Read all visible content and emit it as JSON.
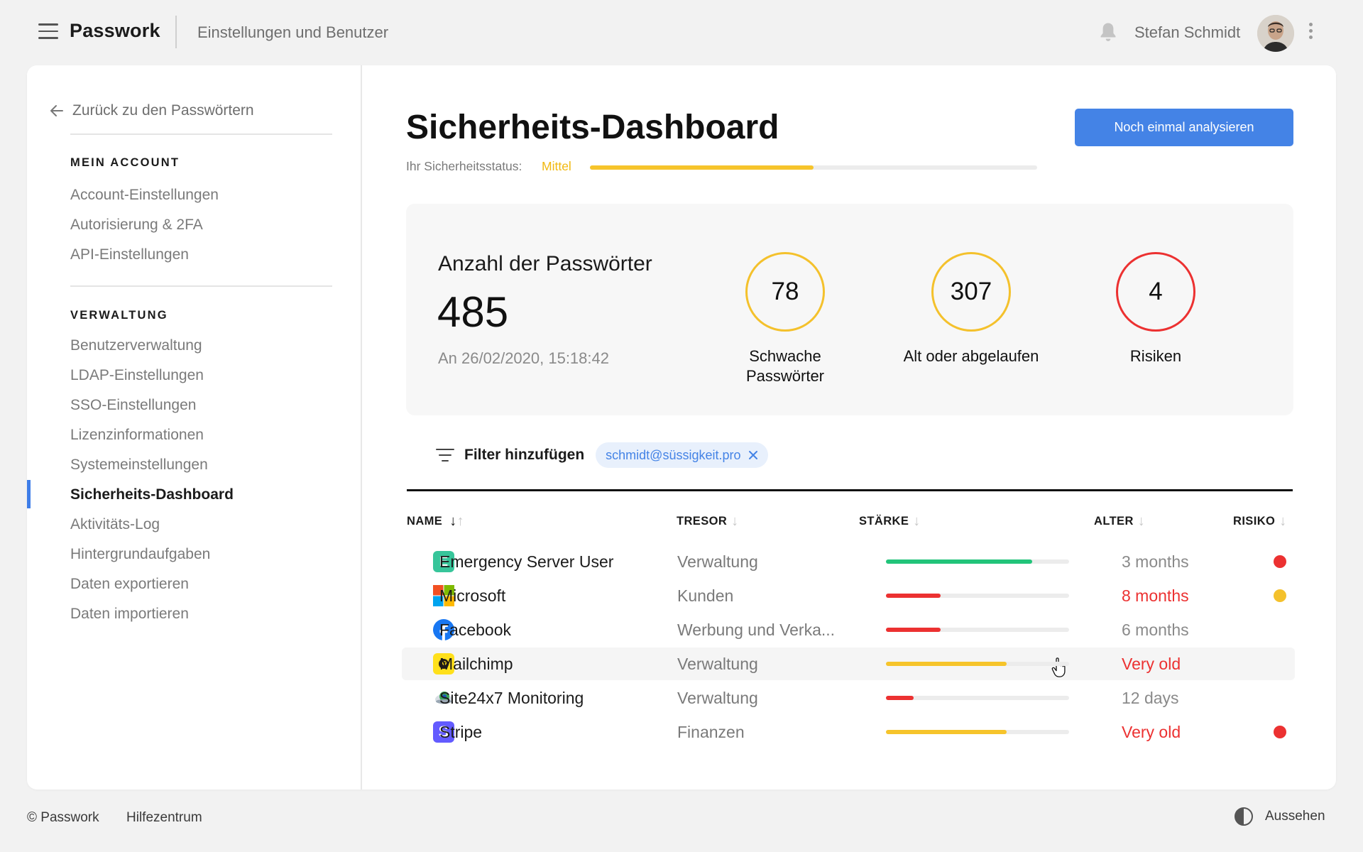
{
  "header": {
    "brand": "Passwork",
    "breadcrumb": "Einstellungen und Benutzer",
    "user_name": "Stefan Schmidt"
  },
  "sidebar": {
    "back_label": "Zurück zu den Passwörtern",
    "sections": [
      {
        "heading": "MEIN ACCOUNT",
        "items": [
          "Account-Einstellungen",
          "Autorisierung & 2FA",
          "API-Einstellungen"
        ]
      },
      {
        "heading": "VERWALTUNG",
        "items": [
          "Benutzerverwaltung",
          "LDAP-Einstellungen",
          "SSO-Einstellungen",
          "Lizenzinformationen",
          "Systemeinstellungen",
          "Sicherheits-Dashboard",
          "Aktivitäts-Log",
          "Hintergrundaufgaben",
          "Daten exportieren",
          "Daten importieren"
        ]
      }
    ],
    "active_item": "Sicherheits-Dashboard"
  },
  "main": {
    "title": "Sicherheits-Dashboard",
    "analyze_button": "Noch einmal analysieren",
    "status_label": "Ihr Sicherheitsstatus:",
    "status_value": "Mittel",
    "status_progress": 0.5,
    "summary": {
      "count_label": "Anzahl der Passwörter",
      "count": "485",
      "date": "An 26/02/2020, 15:18:42",
      "metrics": [
        {
          "value": "78",
          "label": "Schwache Passwörter",
          "color": "#f4c12c"
        },
        {
          "value": "307",
          "label": "Alt oder abgelaufen",
          "color": "#f4c12c"
        },
        {
          "value": "4",
          "label": "Risiken",
          "color": "#ec3131"
        }
      ]
    },
    "filter": {
      "label": "Filter hinzufügen",
      "chip": "schmidt@süssigkeit.pro"
    },
    "table": {
      "columns": [
        "NAME",
        "TRESOR",
        "STÄRKE",
        "ALTER",
        "RISIKO"
      ],
      "rows": [
        {
          "name": "Emergency Server User",
          "vault": "Verwaltung",
          "strength": 0.8,
          "strength_color": "#22c47a",
          "age": "3 months",
          "age_warn": false,
          "risk": "#ec3131",
          "icon": "letter-e-icon"
        },
        {
          "name": "Microsoft",
          "vault": "Kunden",
          "strength": 0.3,
          "strength_color": "#ec3131",
          "age": "8 months",
          "age_warn": true,
          "risk": "#f4c12c",
          "icon": "microsoft-icon"
        },
        {
          "name": "Facebook",
          "vault": "Werbung und Verka...",
          "strength": 0.3,
          "strength_color": "#ec3131",
          "age": "6 months",
          "age_warn": false,
          "risk": null,
          "icon": "facebook-icon"
        },
        {
          "name": "Mailchimp",
          "vault": "Verwaltung",
          "strength": 0.66,
          "strength_color": "#f6c42b",
          "age": "Very old",
          "age_warn": true,
          "risk": null,
          "icon": "mailchimp-icon"
        },
        {
          "name": "Site24x7 Monitoring",
          "vault": "Verwaltung",
          "strength": 0.15,
          "strength_color": "#ec3131",
          "age": "12 days",
          "age_warn": false,
          "risk": null,
          "icon": "site24x7-icon"
        },
        {
          "name": "Stripe",
          "vault": "Finanzen",
          "strength": 0.66,
          "strength_color": "#f6c42b",
          "age": "Very old",
          "age_warn": true,
          "risk": "#ec3131",
          "icon": "stripe-icon"
        }
      ]
    }
  },
  "footer": {
    "copyright": "© Passwork",
    "help": "Hilfezentrum",
    "appearance": "Aussehen"
  },
  "colors": {
    "accent": "#4483e6",
    "warning": "#f4c12c",
    "danger": "#ec3131",
    "success": "#22c47a"
  }
}
